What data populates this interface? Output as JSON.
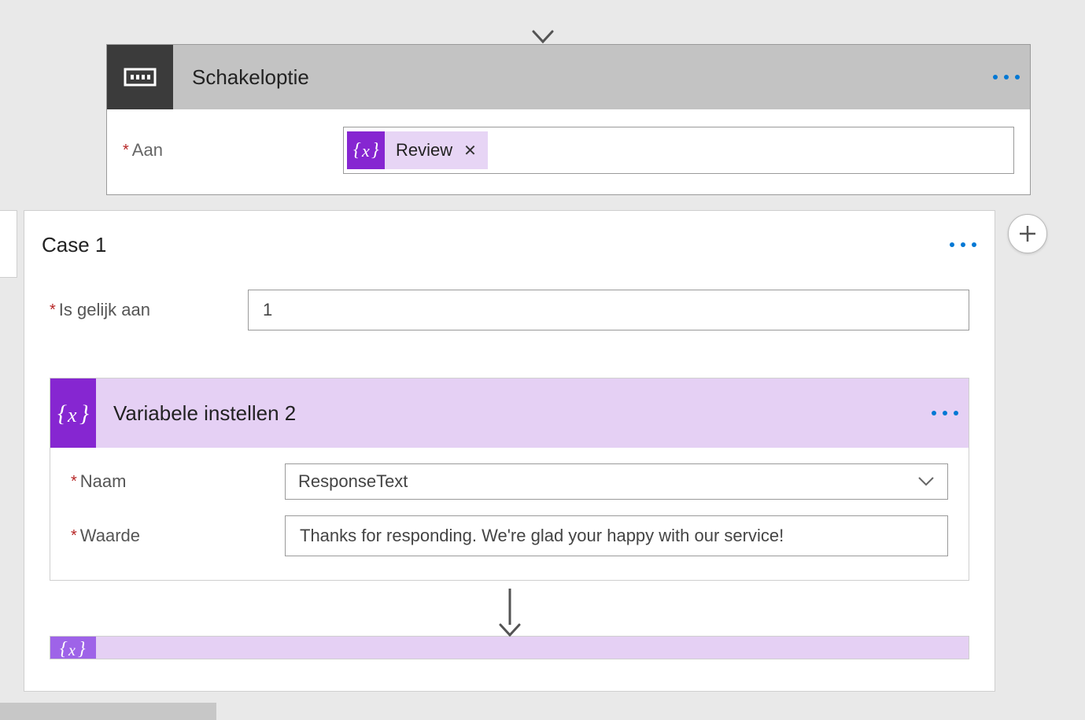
{
  "switch": {
    "title": "Schakeloptie",
    "on_label": "Aan",
    "token_label": "Review"
  },
  "case1": {
    "title": "Case 1",
    "equals_label": "Is gelijk aan",
    "equals_value": "1",
    "set_variable": {
      "title": "Variabele instellen 2",
      "name_label": "Naam",
      "name_value": "ResponseText",
      "value_label": "Waarde",
      "value_value": "Thanks for responding. We're glad your happy with our service!"
    }
  }
}
